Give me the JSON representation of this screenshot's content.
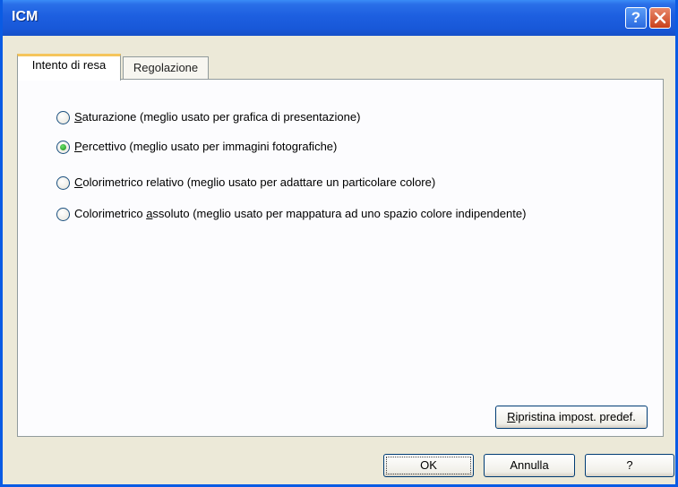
{
  "window": {
    "title": "ICM",
    "help_glyph": "?",
    "close_icon": "close-icon"
  },
  "tabs": [
    {
      "label": "Intento di resa",
      "active": true
    },
    {
      "label": "Regolazione",
      "active": false
    }
  ],
  "options": [
    {
      "accel": "S",
      "rest": "aturazione (meglio usato per grafica di presentazione)",
      "checked": false
    },
    {
      "accel": "P",
      "rest": "ercettivo (meglio usato per immagini fotografiche)",
      "checked": true
    },
    {
      "accel": "C",
      "rest": "olorimetrico relativo (meglio usato per adattare un particolare colore)",
      "checked": false
    },
    {
      "pre": "Colorimetrico ",
      "accel": "a",
      "rest": "ssoluto (meglio usato per mappatura ad uno spazio colore indipendente)",
      "checked": false
    }
  ],
  "restore_button": {
    "accel": "R",
    "rest": "ipristina impost. predef."
  },
  "footer": {
    "ok": "OK",
    "cancel": "Annulla",
    "help": "?"
  },
  "colors": {
    "titlebar": "#1d5fe0",
    "dialog_bg": "#ece9d8",
    "active_tab_accent": "#f5c55c",
    "close_button": "#c9401b"
  }
}
